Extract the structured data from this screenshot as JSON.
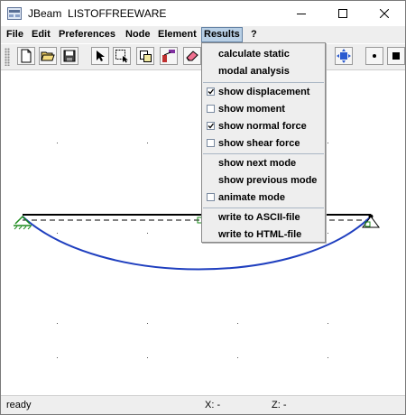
{
  "window": {
    "title": "JBeam  LISTOFFREEWARE",
    "controls": [
      "minimize-icon",
      "maximize-icon",
      "close-icon"
    ]
  },
  "menubar": [
    "File",
    "Edit",
    "Preferences",
    "Node",
    "Element",
    "Results",
    "?"
  ],
  "toolbar": {
    "buttons": [
      "new-file-icon",
      "open-folder-icon",
      "save-disk-icon",
      "pointer-arrow-icon",
      "select-rectangle-icon",
      "copy-icon",
      "node-properties-icon",
      "eraser-icon",
      "fit-view-icon",
      "small-dot-icon",
      "large-dot-icon"
    ]
  },
  "results_menu": {
    "items": [
      {
        "label": "calculate static",
        "checkbox": false
      },
      {
        "label": "modal analysis",
        "checkbox": false
      },
      {
        "label": "show displacement",
        "checkbox": true,
        "checked": true
      },
      {
        "label": "show moment",
        "checkbox": true,
        "checked": false
      },
      {
        "label": "show normal force",
        "checkbox": true,
        "checked": true
      },
      {
        "label": "show shear force",
        "checkbox": true,
        "checked": false
      },
      {
        "label": "show next mode",
        "checkbox": false
      },
      {
        "label": "show previous mode",
        "checkbox": false
      },
      {
        "label": "animate mode",
        "checkbox": true,
        "checked": false
      },
      {
        "label": "write to ASCII-file",
        "checkbox": false
      },
      {
        "label": "write to HTML-file",
        "checkbox": false
      }
    ]
  },
  "status": {
    "message": "ready",
    "x_readout": "X: -",
    "z_readout": "Z: -"
  },
  "colors": {
    "deflection_curve": "#1f3fbf",
    "menu_highlight": "#b8cfe5",
    "support_green": "#1a8a1a"
  }
}
